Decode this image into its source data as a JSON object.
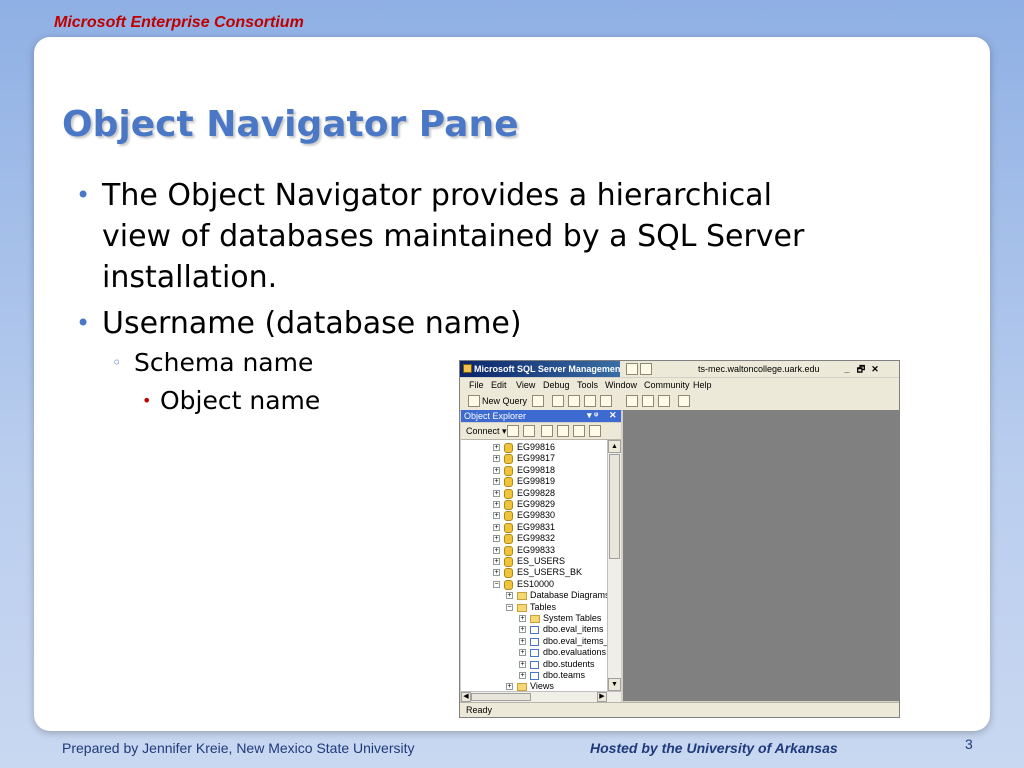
{
  "header": {
    "consortium": "Microsoft Enterprise Consortium"
  },
  "slide": {
    "title": "Object Navigator Pane",
    "bullets": [
      {
        "level": 1,
        "lines": [
          "The Object Navigator provides a hierarchical",
          "view of databases maintained by a SQL Server",
          "installation."
        ]
      },
      {
        "level": 1,
        "lines": [
          "Username (database name)"
        ]
      },
      {
        "level": 2,
        "lines": [
          "Schema name"
        ]
      },
      {
        "level": 3,
        "lines": [
          "Object name"
        ]
      }
    ]
  },
  "ssms": {
    "title": "Microsoft SQL Server Management",
    "server": "ts-mec.waltoncollege.uark.edu",
    "window_buttons": {
      "minimize": "_",
      "restore": "🗗",
      "close": "✕"
    },
    "menu": [
      "File",
      "Edit",
      "View",
      "Debug",
      "Tools",
      "Window",
      "Community",
      "Help"
    ],
    "new_query": "New Query",
    "object_explorer": {
      "title": "Object Explorer",
      "pin": "▾ ᵠ",
      "close": "✕",
      "connect": "Connect ▾",
      "tree": [
        {
          "label": "EG99816",
          "level": 0,
          "icon": "database-icon",
          "expander": "+"
        },
        {
          "label": "EG99817",
          "level": 0,
          "icon": "database-icon",
          "expander": "+"
        },
        {
          "label": "EG99818",
          "level": 0,
          "icon": "database-icon",
          "expander": "+"
        },
        {
          "label": "EG99819",
          "level": 0,
          "icon": "database-icon",
          "expander": "+"
        },
        {
          "label": "EG99828",
          "level": 0,
          "icon": "database-icon",
          "expander": "+"
        },
        {
          "label": "EG99829",
          "level": 0,
          "icon": "database-icon",
          "expander": "+"
        },
        {
          "label": "EG99830",
          "level": 0,
          "icon": "database-icon",
          "expander": "+"
        },
        {
          "label": "EG99831",
          "level": 0,
          "icon": "database-icon",
          "expander": "+"
        },
        {
          "label": "EG99832",
          "level": 0,
          "icon": "database-icon",
          "expander": "+"
        },
        {
          "label": "EG99833",
          "level": 0,
          "icon": "database-icon",
          "expander": "+"
        },
        {
          "label": "ES_USERS",
          "level": 0,
          "icon": "database-icon",
          "expander": "+"
        },
        {
          "label": "ES_USERS_BK",
          "level": 0,
          "icon": "database-icon",
          "expander": "+"
        },
        {
          "label": "ES10000",
          "level": 0,
          "icon": "database-icon",
          "expander": "−"
        },
        {
          "label": "Database Diagrams",
          "level": 1,
          "icon": "folder-icon",
          "expander": "+"
        },
        {
          "label": "Tables",
          "level": 1,
          "icon": "folder-icon",
          "expander": "−"
        },
        {
          "label": "System Tables",
          "level": 2,
          "icon": "folder-icon",
          "expander": "+"
        },
        {
          "label": "dbo.eval_items",
          "level": 2,
          "icon": "table-icon",
          "expander": "+"
        },
        {
          "label": "dbo.eval_items_s",
          "level": 2,
          "icon": "table-icon",
          "expander": "+"
        },
        {
          "label": "dbo.evaluations",
          "level": 2,
          "icon": "table-icon",
          "expander": "+"
        },
        {
          "label": "dbo.students",
          "level": 2,
          "icon": "table-icon",
          "expander": "+"
        },
        {
          "label": "dbo.teams",
          "level": 2,
          "icon": "table-icon",
          "expander": "+"
        },
        {
          "label": "Views",
          "level": 1,
          "icon": "folder-icon",
          "expander": "+"
        }
      ]
    },
    "status": "Ready"
  },
  "footer": {
    "prepared_by": "Prepared by Jennifer Kreie, New Mexico State University",
    "hosted_by": "Hosted by the University of Arkansas",
    "page_number": "3"
  }
}
